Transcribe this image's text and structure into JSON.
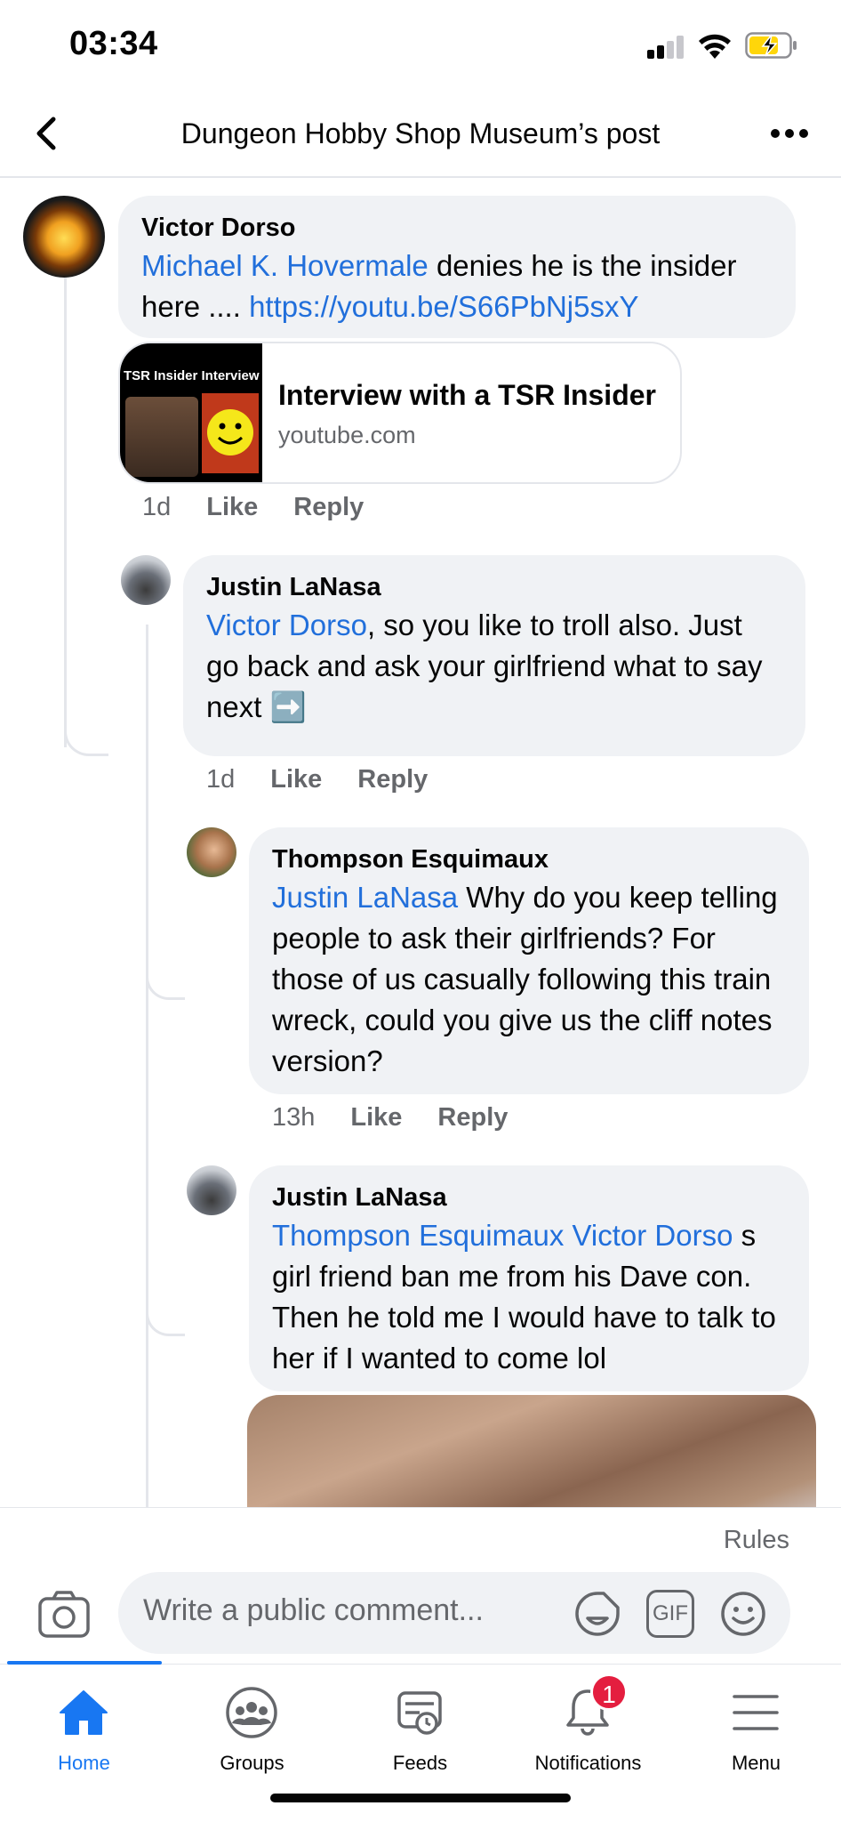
{
  "status_bar": {
    "time": "03:34"
  },
  "nav": {
    "title": "Dungeon Hobby Shop Museum’s post"
  },
  "comments": [
    {
      "author": "Victor Dorso",
      "mention": "Michael K. Hovermale",
      "text_after_mention": " denies he is the insider here .... ",
      "link": "https://youtu.be/S66PbNj5sxY",
      "link_card": {
        "thumb_caption": "TSR Insider Interview",
        "title": "Interview with a TSR Insider",
        "domain": "youtube.com"
      },
      "time": "1d",
      "like_label": "Like",
      "reply_label": "Reply"
    },
    {
      "author": "Justin LaNasa",
      "mention": "Victor Dorso",
      "text": ", so you like to troll also. Just go back and ask your girlfriend what to say next",
      "emoji": "➡️",
      "time": "1d",
      "like_label": "Like",
      "reply_label": "Reply"
    },
    {
      "author": "Thompson Esquimaux",
      "mention": "Justin LaNasa",
      "text": " Why do you keep telling people to ask their girlfriends? For those of us casually following this train wreck, could you give us the cliff notes version?",
      "time": "13h",
      "like_label": "Like",
      "reply_label": "Reply"
    },
    {
      "author": "Justin LaNasa",
      "mention": "Thompson Esquimaux Victor Dorso",
      "text": " s girl friend ban me from his Dave con. Then he told me I would have to talk to her if I wanted to come lol"
    }
  ],
  "composer": {
    "rules_label": "Rules",
    "placeholder": "Write a public comment...",
    "gif_label": "GIF"
  },
  "tabs": [
    {
      "label": "Home",
      "icon": "home-icon",
      "active": true
    },
    {
      "label": "Groups",
      "icon": "groups-icon"
    },
    {
      "label": "Feeds",
      "icon": "feeds-icon"
    },
    {
      "label": "Notifications",
      "icon": "bell-icon",
      "badge": "1"
    },
    {
      "label": "Menu",
      "icon": "menu-icon"
    }
  ],
  "colors": {
    "accent": "#1877f2",
    "mention": "#216fdb",
    "bubble": "#f0f2f5",
    "secondary_text": "#65676b",
    "badge": "#e41e3f"
  }
}
